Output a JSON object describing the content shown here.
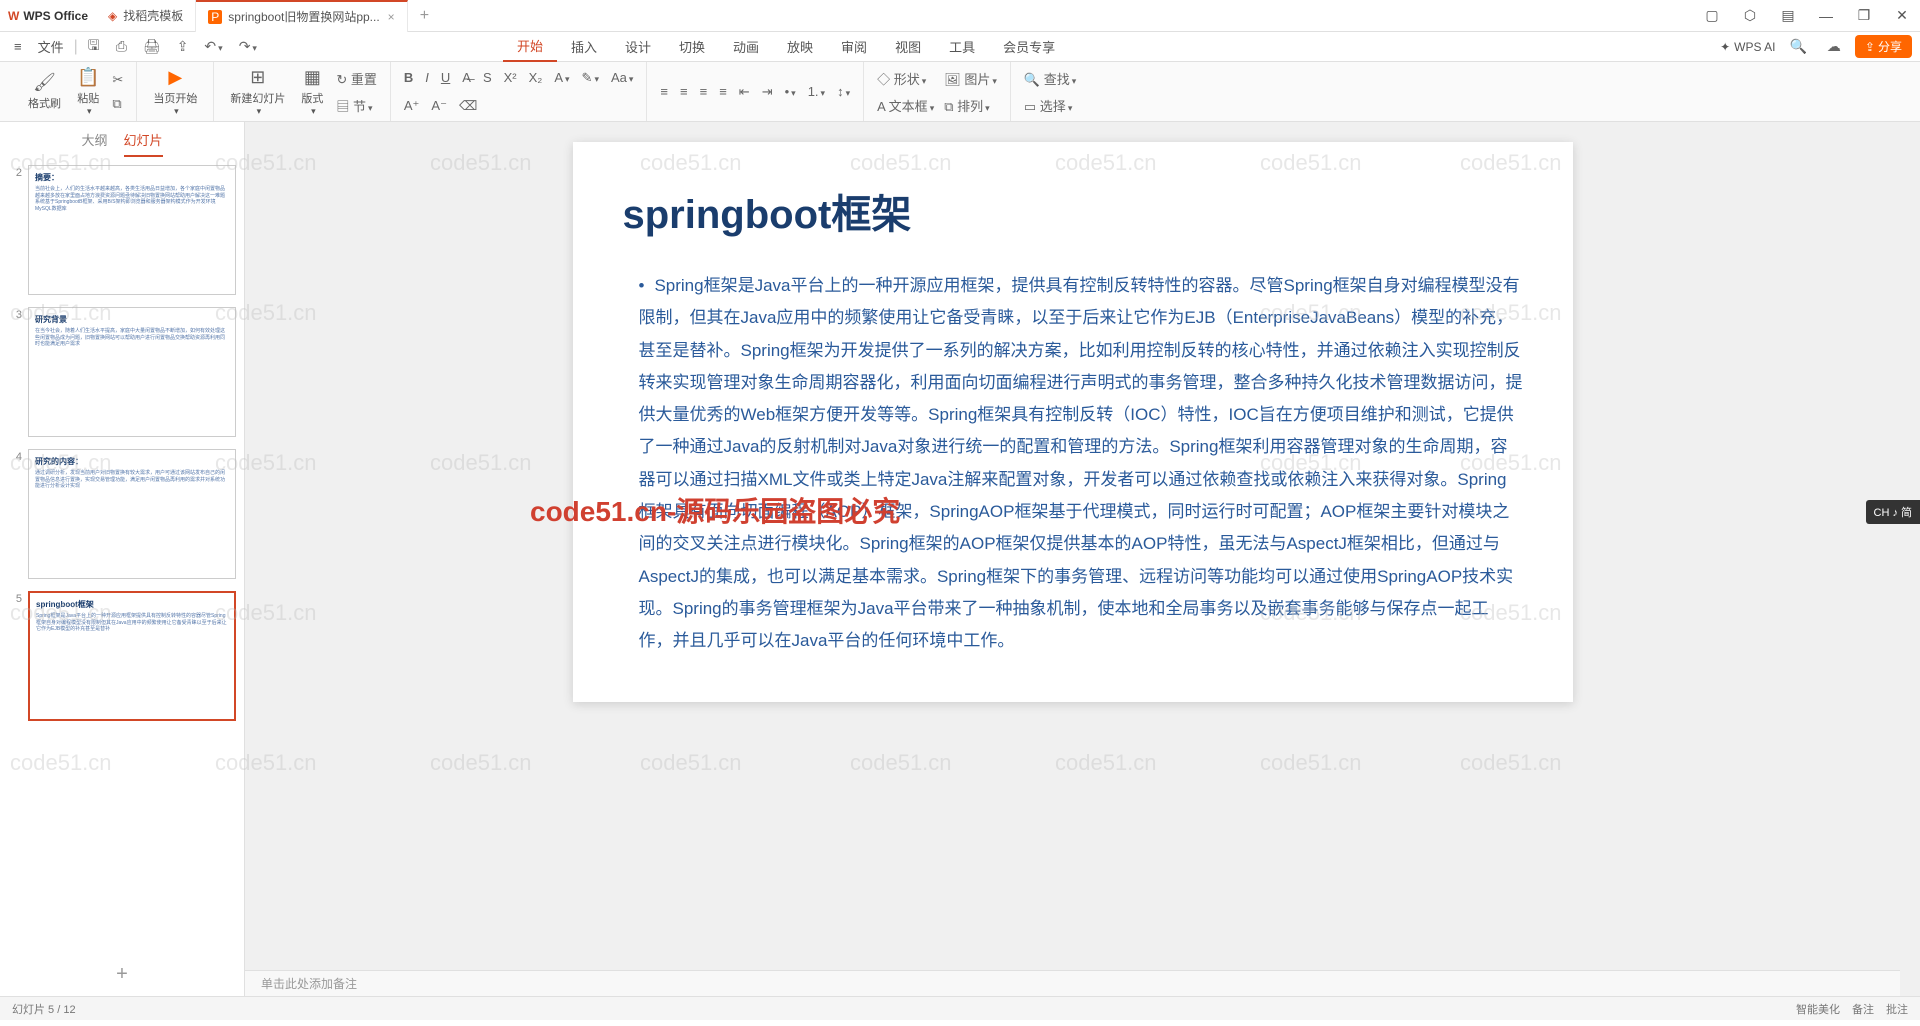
{
  "app": {
    "name": "WPS Office"
  },
  "tabs": [
    {
      "icon": "D",
      "label": "找稻壳模板",
      "icon_color": "#d24726"
    },
    {
      "icon": "P",
      "label": "springboot旧物置换网站pp...",
      "icon_color": "#ff6600",
      "active": true
    }
  ],
  "file_menu": "文件",
  "menu_tabs": [
    "开始",
    "插入",
    "设计",
    "切换",
    "动画",
    "放映",
    "审阅",
    "视图",
    "工具",
    "会员专享"
  ],
  "menu_active_index": 0,
  "wps_ai": "WPS AI",
  "share_label": "分享",
  "ribbon": {
    "format_painter": "格式刷",
    "paste": "粘贴",
    "from_current": "当页开始",
    "new_slide": "新建幻灯片",
    "layout": "版式",
    "reset": "重置",
    "section": "节",
    "shape": "形状",
    "picture": "图片",
    "textbox": "文本框",
    "arrange": "排列",
    "find": "查找",
    "select": "选择"
  },
  "sidebar": {
    "tab_outline": "大纲",
    "tab_slides": "幻灯片",
    "thumbnails": [
      {
        "num": "2",
        "title": "摘要：",
        "preview": "当前社会上，人们的生活水平越来越高，各类生活用品日益增加，各个家庭中闲置物品越来越多放在家里面占地方浪费资源问题亟待解决旧物置换网站帮助用户解决这一难题系统基于SpringbootB框架、采用B/S架构即浏览器和服务器架构模式作为开发环境MySQL数据库"
      },
      {
        "num": "3",
        "title": "研究背景",
        "preview": "在当今社会，随着人们生活水平提高，家庭中大量闲置物品不断增加，如何有效处理这些闲置物品成为问题，旧物置换网站可以帮助用户进行闲置物品交换帮助资源再利用同时也能满足用户需求"
      },
      {
        "num": "4",
        "title": "研究的内容：",
        "preview": "通过调研分析，发现当前用户对旧物置换有较大需求，用户可通过该网站发布自己的闲置物品信息进行置换，实现交易管理功能，满足用户闲置物品再利用的需求并对系统功能进行分析设计实现"
      },
      {
        "num": "5",
        "title": "springboot框架",
        "preview": "Spring框架是Java平台上的一种开源应用框架提供具有控制反转特性的容器尽管Spring框架自身对编程模型没有限制但其在Java应用中的频繁使用让它备受青睐以至于后来让它作为EJB模型的补充甚至是替补",
        "selected": true
      }
    ]
  },
  "slide": {
    "title": "springboot框架",
    "body": "Spring框架是Java平台上的一种开源应用框架，提供具有控制反转特性的容器。尽管Spring框架自身对编程模型没有限制，但其在Java应用中的频繁使用让它备受青睐，以至于后来让它作为EJB（EnterpriseJavaBeans）模型的补充，甚至是替补。Spring框架为开发提供了一系列的解决方案，比如利用控制反转的核心特性，并通过依赖注入实现控制反转来实现管理对象生命周期容器化，利用面向切面编程进行声明式的事务管理，整合多种持久化技术管理数据访问，提供大量优秀的Web框架方便开发等等。Spring框架具有控制反转（IOC）特性，IOC旨在方便项目维护和测试，它提供了一种通过Java的反射机制对Java对象进行统一的配置和管理的方法。Spring框架利用容器管理对象的生命周期，容器可以通过扫描XML文件或类上特定Java注解来配置对象，开发者可以通过依赖查找或依赖注入来获得对象。Spring框架具有面向切面编程（AOP）框架，SpringAOP框架基于代理模式，同时运行时可配置；AOP框架主要针对模块之间的交叉关注点进行模块化。Spring框架的AOP框架仅提供基本的AOP特性，虽无法与AspectJ框架相比，但通过与AspectJ的集成，也可以满足基本需求。Spring框架下的事务管理、远程访问等功能均可以通过使用SpringAOP技术实现。Spring的事务管理框架为Java平台带来了一种抽象机制，使本地和全局事务以及嵌套事务能够与保存点一起工作，并且几乎可以在Java平台的任何环境中工作。"
  },
  "notes_placeholder": "单击此处添加备注",
  "status": {
    "slide_info": "幻灯片 5 / 12",
    "right_items": [
      "智能美化",
      "备注",
      "批注"
    ]
  },
  "watermark_text": "code51.cn",
  "watermark_red": "code51.cn-源码乐园盗图必究",
  "ch_badge": "CH ♪ 简"
}
